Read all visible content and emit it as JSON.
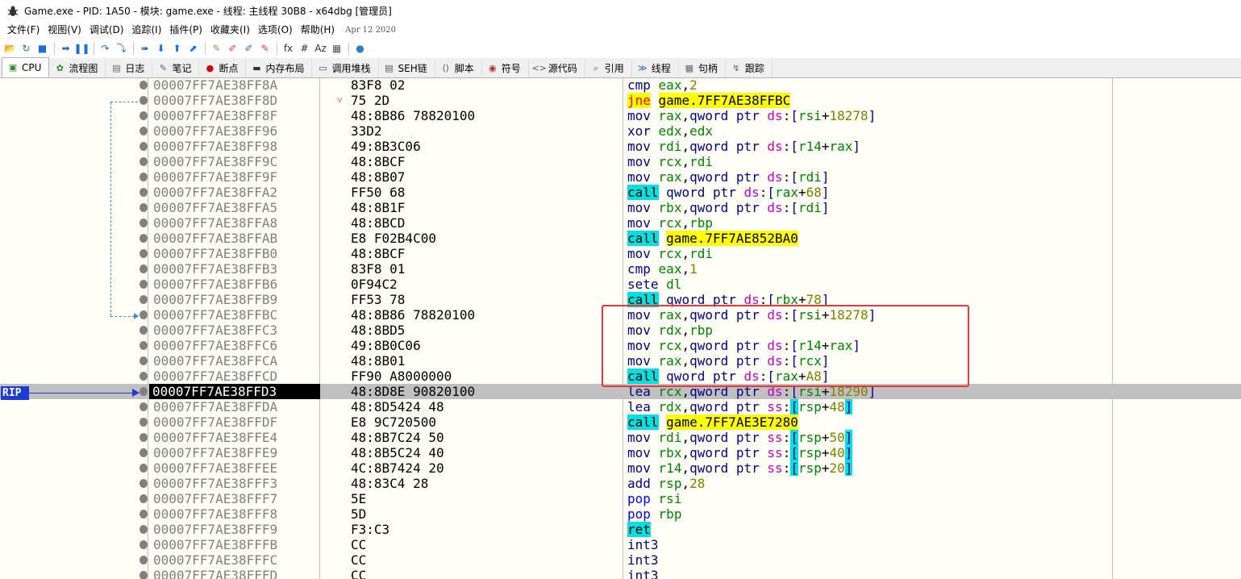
{
  "window": {
    "title": "Game.exe - PID: 1A50 - 模块: game.exe - 线程: 主线程 30B8 - x64dbg [管理员]"
  },
  "menu": {
    "items": [
      "文件(F)",
      "视图(V)",
      "调试(D)",
      "追踪(I)",
      "插件(P)",
      "收藏夹(I)",
      "选项(O)",
      "帮助(H)"
    ],
    "date": "Apr 12 2020"
  },
  "toolbar": {
    "icons": [
      "open-icon",
      "restart-icon",
      "stop-icon",
      "run-icon",
      "pause-icon",
      "step-into-icon",
      "step-over-icon",
      "trace-into-icon",
      "trace-over-icon",
      "execute-till-return-icon",
      "run-to-user-code-icon",
      "patch-icon",
      "comment-icon",
      "label-icon",
      "bookmark-icon",
      "function-icon",
      "hash-icon",
      "font-icon",
      "calculator-icon",
      "favourites-icon"
    ],
    "glyphs": [
      "📂",
      "↻",
      "■",
      "➡",
      "❚❚",
      "↷",
      "⤵",
      "➠",
      "⬇",
      "⬆",
      "⬈",
      "✎",
      "✐",
      "✐",
      "✎",
      "fx",
      "#",
      "Az",
      "▦",
      "●"
    ]
  },
  "tabs": [
    {
      "label": "CPU",
      "icon": "cpu-icon",
      "glyph": "▣",
      "active": true
    },
    {
      "label": "流程图",
      "icon": "graph-icon",
      "glyph": "✿",
      "active": false
    },
    {
      "label": "日志",
      "icon": "log-icon",
      "glyph": "▤",
      "active": false
    },
    {
      "label": "笔记",
      "icon": "notes-icon",
      "glyph": "✎",
      "active": false
    },
    {
      "label": "断点",
      "icon": "breakpoint-icon",
      "glyph": "●",
      "active": false
    },
    {
      "label": "内存布局",
      "icon": "memory-map-icon",
      "glyph": "▬",
      "active": false
    },
    {
      "label": "调用堆栈",
      "icon": "call-stack-icon",
      "glyph": "▭",
      "active": false
    },
    {
      "label": "SEH链",
      "icon": "seh-icon",
      "glyph": "▤",
      "active": false
    },
    {
      "label": "脚本",
      "icon": "script-icon",
      "glyph": "⟨⟩",
      "active": false
    },
    {
      "label": "符号",
      "icon": "symbols-icon",
      "glyph": "◉",
      "active": false
    },
    {
      "label": "源代码",
      "icon": "source-icon",
      "glyph": "<>",
      "active": false
    },
    {
      "label": "引用",
      "icon": "references-icon",
      "glyph": "⌕",
      "active": false
    },
    {
      "label": "线程",
      "icon": "threads-icon",
      "glyph": "≫",
      "active": false
    },
    {
      "label": "句柄",
      "icon": "handles-icon",
      "glyph": "▦",
      "active": false
    },
    {
      "label": "跟踪",
      "icon": "trace-icon",
      "glyph": "↯",
      "active": false
    }
  ],
  "rip_label": "RIP",
  "current_index": 20,
  "jump_arrow": "˅",
  "rows": [
    {
      "addr": "00007FF7AE38FF8A",
      "bytes": "83F8 02",
      "instr": [
        [
          "m",
          "cmp"
        ],
        [
          "k",
          " "
        ],
        [
          "r",
          "eax"
        ],
        [
          "k",
          ","
        ],
        [
          "n",
          "2"
        ]
      ]
    },
    {
      "addr": "00007FF7AE38FF8D",
      "bytes": "75 2D",
      "jump": true,
      "instr": [
        [
          "jmp",
          "jne"
        ],
        [
          "k",
          " "
        ],
        [
          "tgt",
          "game.7FF7AE38FFBC"
        ]
      ]
    },
    {
      "addr": "00007FF7AE38FF8F",
      "bytes": "48:8B86 78820100",
      "instr": [
        [
          "m",
          "mov"
        ],
        [
          "k",
          " "
        ],
        [
          "r",
          "rax"
        ],
        [
          "k",
          ","
        ],
        [
          "m",
          "qword ptr "
        ],
        [
          "s",
          "ds"
        ],
        [
          "k",
          ":"
        ],
        [
          "b",
          "["
        ],
        [
          "r",
          "rsi"
        ],
        [
          "k",
          "+"
        ],
        [
          "n",
          "18278"
        ],
        [
          "b",
          "]"
        ]
      ]
    },
    {
      "addr": "00007FF7AE38FF96",
      "bytes": "33D2",
      "instr": [
        [
          "m",
          "xor"
        ],
        [
          "k",
          " "
        ],
        [
          "r",
          "edx"
        ],
        [
          "k",
          ","
        ],
        [
          "r",
          "edx"
        ]
      ]
    },
    {
      "addr": "00007FF7AE38FF98",
      "bytes": "49:8B3C06",
      "instr": [
        [
          "m",
          "mov"
        ],
        [
          "k",
          " "
        ],
        [
          "r",
          "rdi"
        ],
        [
          "k",
          ","
        ],
        [
          "m",
          "qword ptr "
        ],
        [
          "s",
          "ds"
        ],
        [
          "k",
          ":"
        ],
        [
          "b",
          "["
        ],
        [
          "r",
          "r14"
        ],
        [
          "k",
          "+"
        ],
        [
          "r",
          "rax"
        ],
        [
          "b",
          "]"
        ]
      ]
    },
    {
      "addr": "00007FF7AE38FF9C",
      "bytes": "48:8BCF",
      "instr": [
        [
          "m",
          "mov"
        ],
        [
          "k",
          " "
        ],
        [
          "r",
          "rcx"
        ],
        [
          "k",
          ","
        ],
        [
          "r",
          "rdi"
        ]
      ]
    },
    {
      "addr": "00007FF7AE38FF9F",
      "bytes": "48:8B07",
      "instr": [
        [
          "m",
          "mov"
        ],
        [
          "k",
          " "
        ],
        [
          "r",
          "rax"
        ],
        [
          "k",
          ","
        ],
        [
          "m",
          "qword ptr "
        ],
        [
          "s",
          "ds"
        ],
        [
          "k",
          ":"
        ],
        [
          "b",
          "["
        ],
        [
          "r",
          "rdi"
        ],
        [
          "b",
          "]"
        ]
      ]
    },
    {
      "addr": "00007FF7AE38FFA2",
      "bytes": "FF50 68",
      "instr": [
        [
          "call",
          "call"
        ],
        [
          "k",
          " "
        ],
        [
          "m",
          "qword ptr "
        ],
        [
          "s",
          "ds"
        ],
        [
          "k",
          ":"
        ],
        [
          "b",
          "["
        ],
        [
          "r",
          "rax"
        ],
        [
          "k",
          "+"
        ],
        [
          "n",
          "68"
        ],
        [
          "b",
          "]"
        ]
      ]
    },
    {
      "addr": "00007FF7AE38FFA5",
      "bytes": "48:8B1F",
      "instr": [
        [
          "m",
          "mov"
        ],
        [
          "k",
          " "
        ],
        [
          "r",
          "rbx"
        ],
        [
          "k",
          ","
        ],
        [
          "m",
          "qword ptr "
        ],
        [
          "s",
          "ds"
        ],
        [
          "k",
          ":"
        ],
        [
          "b",
          "["
        ],
        [
          "r",
          "rdi"
        ],
        [
          "b",
          "]"
        ]
      ]
    },
    {
      "addr": "00007FF7AE38FFA8",
      "bytes": "48:8BCD",
      "instr": [
        [
          "m",
          "mov"
        ],
        [
          "k",
          " "
        ],
        [
          "r",
          "rcx"
        ],
        [
          "k",
          ","
        ],
        [
          "r",
          "rbp"
        ]
      ]
    },
    {
      "addr": "00007FF7AE38FFAB",
      "bytes": "E8 F02B4C00",
      "instr": [
        [
          "call",
          "call"
        ],
        [
          "k",
          " "
        ],
        [
          "tgt",
          "game.7FF7AE852BA0"
        ]
      ]
    },
    {
      "addr": "00007FF7AE38FFB0",
      "bytes": "48:8BCF",
      "instr": [
        [
          "m",
          "mov"
        ],
        [
          "k",
          " "
        ],
        [
          "r",
          "rcx"
        ],
        [
          "k",
          ","
        ],
        [
          "r",
          "rdi"
        ]
      ]
    },
    {
      "addr": "00007FF7AE38FFB3",
      "bytes": "83F8 01",
      "instr": [
        [
          "m",
          "cmp"
        ],
        [
          "k",
          " "
        ],
        [
          "r",
          "eax"
        ],
        [
          "k",
          ","
        ],
        [
          "n",
          "1"
        ]
      ]
    },
    {
      "addr": "00007FF7AE38FFB6",
      "bytes": "0F94C2",
      "instr": [
        [
          "m",
          "sete"
        ],
        [
          "k",
          " "
        ],
        [
          "r",
          "dl"
        ]
      ]
    },
    {
      "addr": "00007FF7AE38FFB9",
      "bytes": "FF53 78",
      "instr": [
        [
          "call",
          "call"
        ],
        [
          "k",
          " "
        ],
        [
          "m",
          "qword ptr "
        ],
        [
          "s",
          "ds"
        ],
        [
          "k",
          ":"
        ],
        [
          "b",
          "["
        ],
        [
          "r",
          "rbx"
        ],
        [
          "k",
          "+"
        ],
        [
          "n",
          "78"
        ],
        [
          "b",
          "]"
        ]
      ]
    },
    {
      "addr": "00007FF7AE38FFBC",
      "bytes": "48:8B86 78820100",
      "instr": [
        [
          "m",
          "mov"
        ],
        [
          "k",
          " "
        ],
        [
          "r",
          "rax"
        ],
        [
          "k",
          ","
        ],
        [
          "m",
          "qword ptr "
        ],
        [
          "s",
          "ds"
        ],
        [
          "k",
          ":"
        ],
        [
          "b",
          "["
        ],
        [
          "r",
          "rsi"
        ],
        [
          "k",
          "+"
        ],
        [
          "n",
          "18278"
        ],
        [
          "b",
          "]"
        ]
      ]
    },
    {
      "addr": "00007FF7AE38FFC3",
      "bytes": "48:8BD5",
      "instr": [
        [
          "m",
          "mov"
        ],
        [
          "k",
          " "
        ],
        [
          "r",
          "rdx"
        ],
        [
          "k",
          ","
        ],
        [
          "r",
          "rbp"
        ]
      ]
    },
    {
      "addr": "00007FF7AE38FFC6",
      "bytes": "49:8B0C06",
      "instr": [
        [
          "m",
          "mov"
        ],
        [
          "k",
          " "
        ],
        [
          "r",
          "rcx"
        ],
        [
          "k",
          ","
        ],
        [
          "m",
          "qword ptr "
        ],
        [
          "s",
          "ds"
        ],
        [
          "k",
          ":"
        ],
        [
          "b",
          "["
        ],
        [
          "r",
          "r14"
        ],
        [
          "k",
          "+"
        ],
        [
          "r",
          "rax"
        ],
        [
          "b",
          "]"
        ]
      ]
    },
    {
      "addr": "00007FF7AE38FFCA",
      "bytes": "48:8B01",
      "instr": [
        [
          "m",
          "mov"
        ],
        [
          "k",
          " "
        ],
        [
          "r",
          "rax"
        ],
        [
          "k",
          ","
        ],
        [
          "m",
          "qword ptr "
        ],
        [
          "s",
          "ds"
        ],
        [
          "k",
          ":"
        ],
        [
          "b",
          "["
        ],
        [
          "r",
          "rcx"
        ],
        [
          "b",
          "]"
        ]
      ]
    },
    {
      "addr": "00007FF7AE38FFCD",
      "bytes": "FF90 A8000000",
      "instr": [
        [
          "call",
          "call"
        ],
        [
          "k",
          " "
        ],
        [
          "m",
          "qword ptr "
        ],
        [
          "s",
          "ds"
        ],
        [
          "k",
          ":"
        ],
        [
          "b",
          "["
        ],
        [
          "r",
          "rax"
        ],
        [
          "k",
          "+"
        ],
        [
          "n",
          "A8"
        ],
        [
          "b",
          "]"
        ]
      ]
    },
    {
      "addr": "00007FF7AE38FFD3",
      "bytes": "48:8D8E 90820100",
      "instr": [
        [
          "m",
          "lea"
        ],
        [
          "k",
          " "
        ],
        [
          "r",
          "rcx"
        ],
        [
          "k",
          ","
        ],
        [
          "m",
          "qword ptr "
        ],
        [
          "s",
          "ds"
        ],
        [
          "k",
          ":"
        ],
        [
          "b",
          "["
        ],
        [
          "r",
          "rsi"
        ],
        [
          "k",
          "+"
        ],
        [
          "n",
          "18290"
        ],
        [
          "b",
          "]"
        ]
      ]
    },
    {
      "addr": "00007FF7AE38FFDA",
      "bytes": "48:8D5424 48",
      "instr": [
        [
          "m",
          "lea"
        ],
        [
          "k",
          " "
        ],
        [
          "r",
          "rdx"
        ],
        [
          "k",
          ","
        ],
        [
          "m",
          "qword ptr "
        ],
        [
          "s",
          "ss"
        ],
        [
          "k",
          ":"
        ],
        [
          "ssb",
          "["
        ],
        [
          "r",
          "rsp"
        ],
        [
          "k",
          "+"
        ],
        [
          "n",
          "48"
        ],
        [
          "ssb",
          "]"
        ]
      ]
    },
    {
      "addr": "00007FF7AE38FFDF",
      "bytes": "E8 9C720500",
      "instr": [
        [
          "call",
          "call"
        ],
        [
          "k",
          " "
        ],
        [
          "tgt",
          "game.7FF7AE3E7280"
        ]
      ]
    },
    {
      "addr": "00007FF7AE38FFE4",
      "bytes": "48:8B7C24 50",
      "instr": [
        [
          "m",
          "mov"
        ],
        [
          "k",
          " "
        ],
        [
          "r",
          "rdi"
        ],
        [
          "k",
          ","
        ],
        [
          "m",
          "qword ptr "
        ],
        [
          "s",
          "ss"
        ],
        [
          "k",
          ":"
        ],
        [
          "ssb",
          "["
        ],
        [
          "r",
          "rsp"
        ],
        [
          "k",
          "+"
        ],
        [
          "n",
          "50"
        ],
        [
          "ssb",
          "]"
        ]
      ]
    },
    {
      "addr": "00007FF7AE38FFE9",
      "bytes": "48:8B5C24 40",
      "instr": [
        [
          "m",
          "mov"
        ],
        [
          "k",
          " "
        ],
        [
          "r",
          "rbx"
        ],
        [
          "k",
          ","
        ],
        [
          "m",
          "qword ptr "
        ],
        [
          "s",
          "ss"
        ],
        [
          "k",
          ":"
        ],
        [
          "ssb",
          "["
        ],
        [
          "r",
          "rsp"
        ],
        [
          "k",
          "+"
        ],
        [
          "n",
          "40"
        ],
        [
          "ssb",
          "]"
        ]
      ]
    },
    {
      "addr": "00007FF7AE38FFEE",
      "bytes": "4C:8B7424 20",
      "instr": [
        [
          "m",
          "mov"
        ],
        [
          "k",
          " "
        ],
        [
          "r",
          "r14"
        ],
        [
          "k",
          ","
        ],
        [
          "m",
          "qword ptr "
        ],
        [
          "s",
          "ss"
        ],
        [
          "k",
          ":"
        ],
        [
          "ssb",
          "["
        ],
        [
          "r",
          "rsp"
        ],
        [
          "k",
          "+"
        ],
        [
          "n",
          "20"
        ],
        [
          "ssb",
          "]"
        ]
      ]
    },
    {
      "addr": "00007FF7AE38FFF3",
      "bytes": "48:83C4 28",
      "instr": [
        [
          "m",
          "add"
        ],
        [
          "k",
          " "
        ],
        [
          "r",
          "rsp"
        ],
        [
          "k",
          ","
        ],
        [
          "n",
          "28"
        ]
      ]
    },
    {
      "addr": "00007FF7AE38FFF7",
      "bytes": "5E",
      "instr": [
        [
          "pop",
          "pop"
        ],
        [
          "k",
          " "
        ],
        [
          "r",
          "rsi"
        ]
      ]
    },
    {
      "addr": "00007FF7AE38FFF8",
      "bytes": "5D",
      "instr": [
        [
          "pop",
          "pop"
        ],
        [
          "k",
          " "
        ],
        [
          "r",
          "rbp"
        ]
      ]
    },
    {
      "addr": "00007FF7AE38FFF9",
      "bytes": "F3:C3",
      "instr": [
        [
          "ret",
          "ret"
        ]
      ]
    },
    {
      "addr": "00007FF7AE38FFFB",
      "bytes": "CC",
      "instr": [
        [
          "m",
          "int3"
        ]
      ]
    },
    {
      "addr": "00007FF7AE38FFFC",
      "bytes": "CC",
      "instr": [
        [
          "m",
          "int3"
        ]
      ]
    },
    {
      "addr": "00007FF7AE38FFFD",
      "bytes": "CC",
      "instr": [
        [
          "m",
          "int3"
        ]
      ]
    }
  ]
}
